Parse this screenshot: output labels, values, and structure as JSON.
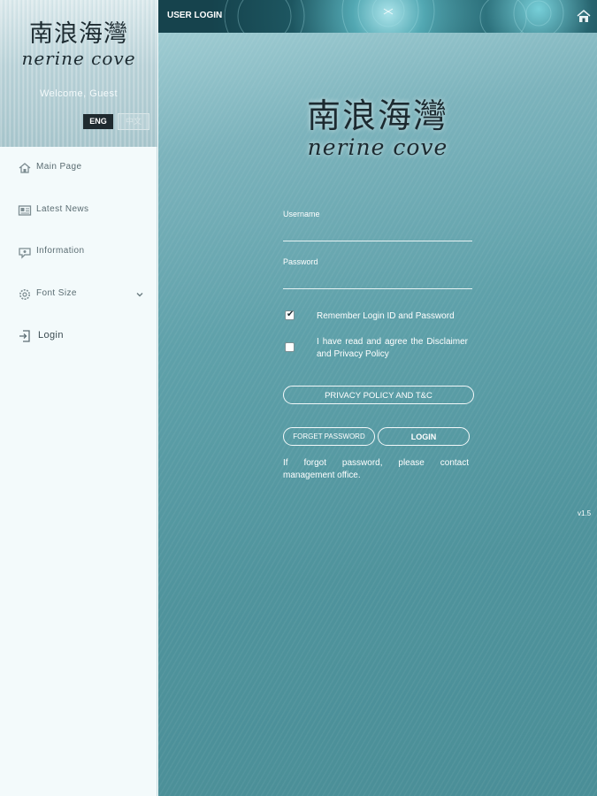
{
  "app": {
    "logo_cn": "南浪海灣",
    "logo_en": "nerine cove"
  },
  "sidebar": {
    "welcome": "Welcome, Guest",
    "lang_active": "ENG",
    "lang_other": "中文",
    "items": [
      {
        "label": "Main Page",
        "icon": "home-icon"
      },
      {
        "label": "Latest News",
        "icon": "news-icon"
      },
      {
        "label": "Information",
        "icon": "info-icon"
      },
      {
        "label": "Font Size",
        "icon": "gear-icon",
        "expandable": true
      },
      {
        "label": "Login",
        "icon": "login-icon"
      }
    ]
  },
  "topbar": {
    "title": "USER LOGIN"
  },
  "form": {
    "username_label": "Username",
    "username_value": "",
    "password_label": "Password",
    "password_value": "",
    "remember_label": "Remember Login ID and Password",
    "remember_checked": true,
    "agree_label": "I have read and agree the Disclaimer and Privacy Policy",
    "agree_checked": false,
    "privacy_button": "PRIVACY POLICY AND T&C",
    "forget_button": "FORGET PASSWORD",
    "login_button": "LOGIN",
    "forgot_note": "If forgot password, please contact management office."
  },
  "version": "v1.5",
  "colors": {
    "sidebar_bg": "#f3fafb",
    "main_teal": "#5fa1aa",
    "topbar_dark": "#0b242a",
    "text_dark": "#1c2a30"
  }
}
